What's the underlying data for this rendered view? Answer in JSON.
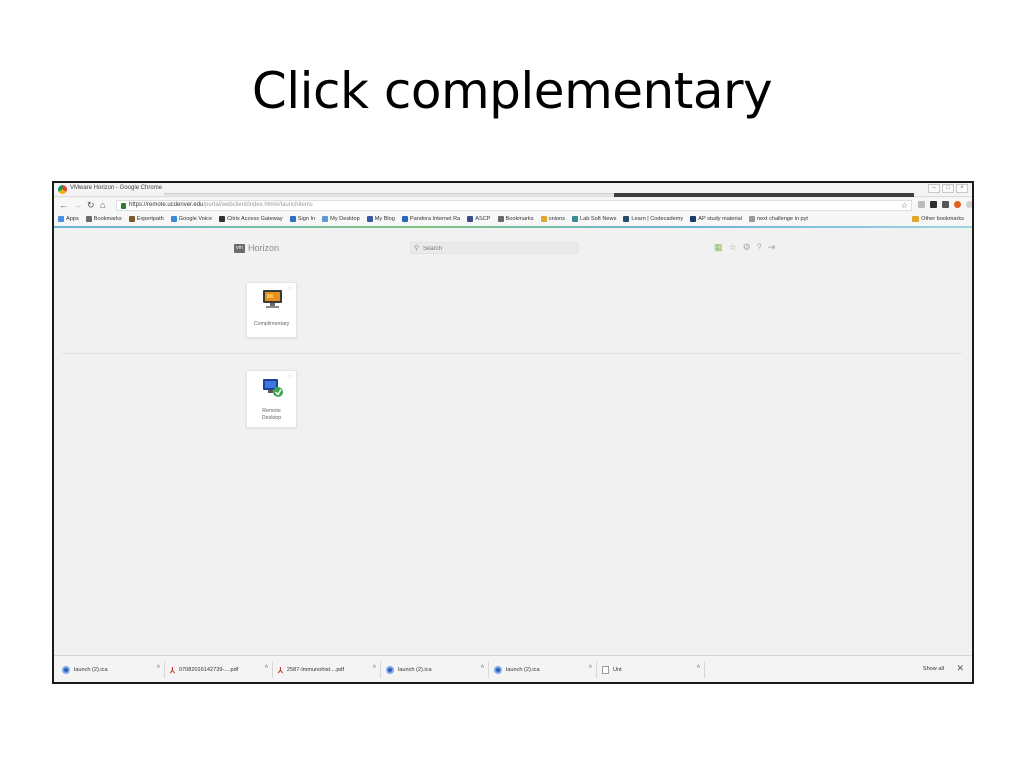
{
  "slide": {
    "title": "Click complementary"
  },
  "window": {
    "title": "VMware Horizon - Google Chrome",
    "controls": [
      "–",
      "□",
      "×"
    ]
  },
  "address_bar": {
    "url_main": "https://remote.ucdenver.edu",
    "url_path": "/portal/webclient/index.html#/launchitems"
  },
  "bookmarks": {
    "items": [
      {
        "label": "Apps",
        "color": "#4a8fe0"
      },
      {
        "label": "Bookmarks",
        "color": "#6a6a6a"
      },
      {
        "label": "Expertpath",
        "color": "#7a5a2a"
      },
      {
        "label": "Google Voice",
        "color": "#3a88d8"
      },
      {
        "label": "Citrix Access Gateway",
        "color": "#333333"
      },
      {
        "label": "Sign In",
        "color": "#2f6fc0"
      },
      {
        "label": "My Desktop",
        "color": "#5a9ad0"
      },
      {
        "label": "My Blog",
        "color": "#3a5aa8"
      },
      {
        "label": "Pandora Internet Ra",
        "color": "#2a6ab8"
      },
      {
        "label": "ASCP",
        "color": "#3a4a8a"
      },
      {
        "label": "Bookmarks",
        "color": "#6a6a6a"
      },
      {
        "label": "onions",
        "color": "#e0a82e"
      },
      {
        "label": "Lab Soft News",
        "color": "#3a8a9a"
      },
      {
        "label": "Learn | Codecademy",
        "color": "#2a4a6a"
      },
      {
        "label": "AP study material",
        "color": "#1a3a6a"
      },
      {
        "label": "next challenge in pyt",
        "color": "#9a9a9a"
      }
    ],
    "other": "Other bookmarks"
  },
  "horizon": {
    "brand": "Horizon",
    "badge": "vm",
    "search_placeholder": "Search",
    "tiles": [
      {
        "label_lines": [
          "Complimentary"
        ]
      },
      {
        "label_lines": [
          "Remote",
          "Desktop"
        ]
      }
    ]
  },
  "downloads": {
    "items": [
      {
        "name": "launch (2).ica",
        "type": "ica"
      },
      {
        "name": "07082016142739-....pdf",
        "type": "pdf"
      },
      {
        "name": "2587-Immunohist....pdf",
        "type": "pdf"
      },
      {
        "name": "launch (2).ica",
        "type": "ica"
      },
      {
        "name": "launch (2).ica",
        "type": "ica"
      },
      {
        "name": "Unt",
        "type": "txt"
      }
    ],
    "show_all": "Show all"
  }
}
